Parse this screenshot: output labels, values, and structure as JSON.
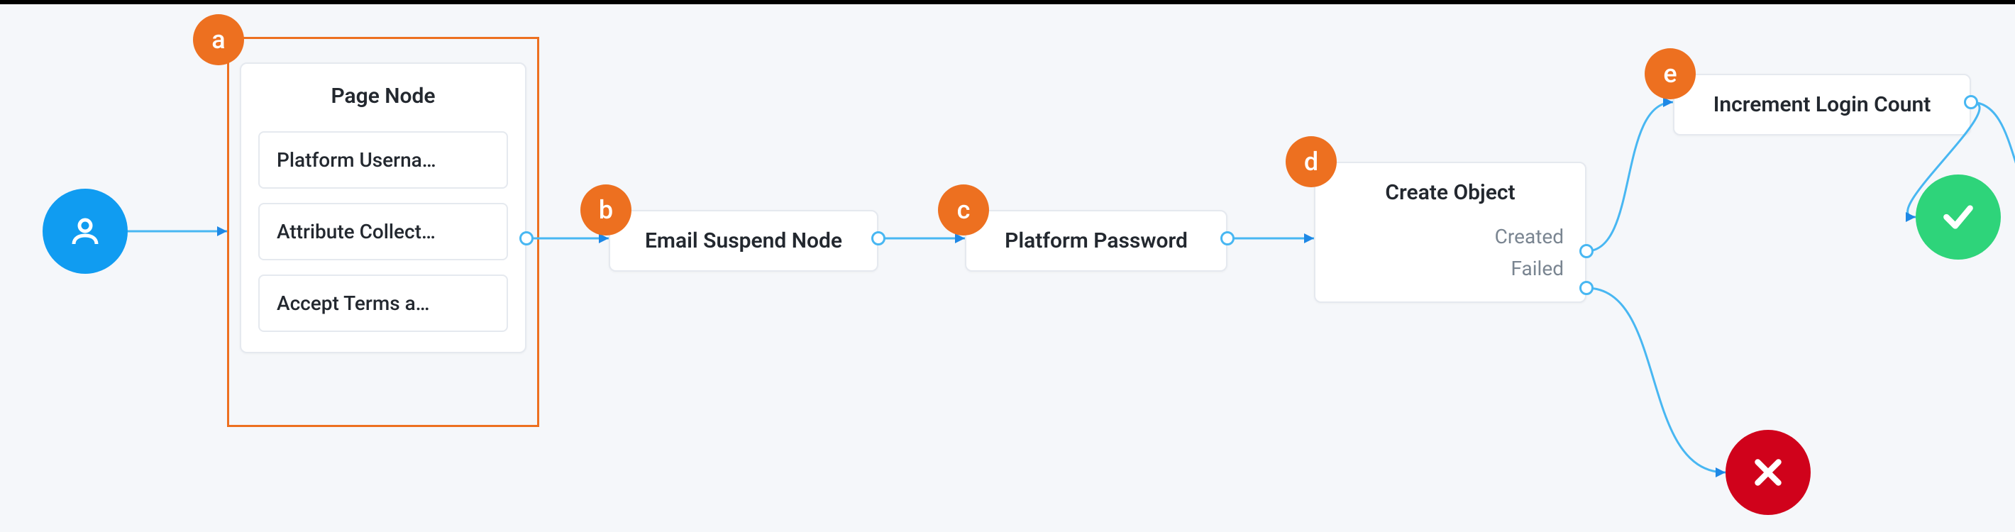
{
  "badges": {
    "a": "a",
    "b": "b",
    "c": "c",
    "d": "d",
    "e": "e"
  },
  "start": {
    "icon": "user-icon"
  },
  "pageNode": {
    "title": "Page Node",
    "items": [
      "Platform Userna…",
      "Attribute Collect…",
      "Accept Terms a…"
    ]
  },
  "nodeB": {
    "title": "Email Suspend Node"
  },
  "nodeC": {
    "title": "Platform Password"
  },
  "nodeD": {
    "title": "Create Object",
    "outputs": [
      "Created",
      "Failed"
    ]
  },
  "nodeE": {
    "title": "Increment Login Count"
  },
  "success": {
    "icon": "check-icon"
  },
  "fail": {
    "icon": "x-icon"
  },
  "colors": {
    "accent": "#ed7020",
    "startBlue": "#109cf1",
    "connectorBlue": "#48b7f2",
    "successGreen": "#2ed47a",
    "failRed": "#d0021b"
  }
}
